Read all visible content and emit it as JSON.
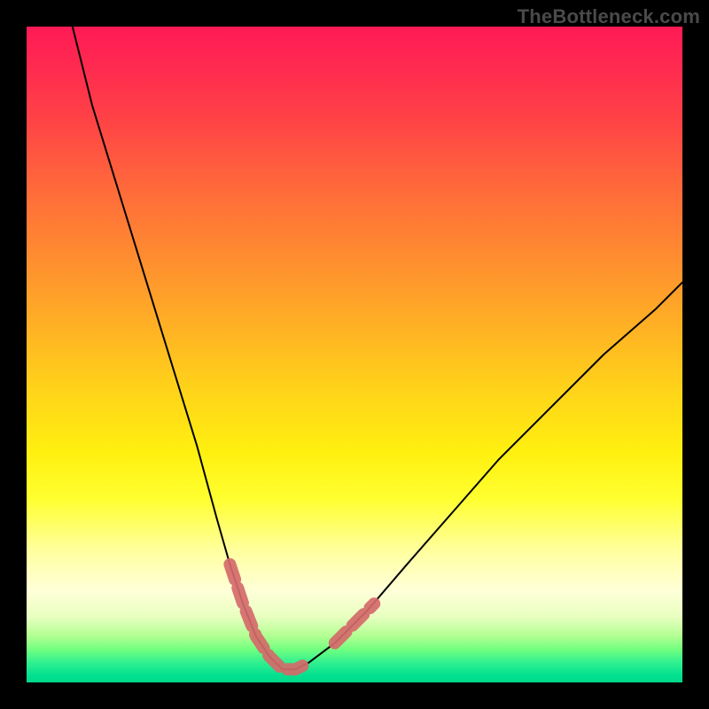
{
  "watermark": "TheBottleneck.com",
  "chart_data": {
    "type": "line",
    "title": "",
    "xlabel": "",
    "ylabel": "",
    "xlim": [
      0,
      100
    ],
    "ylim": [
      0,
      100
    ],
    "grid": false,
    "series": [
      {
        "name": "bottleneck-curve",
        "x": [
          7,
          10,
          14,
          18,
          22,
          26,
          29,
          31,
          33,
          35,
          37,
          39,
          41,
          43,
          47,
          52,
          58,
          65,
          72,
          80,
          88,
          96,
          100
        ],
        "y": [
          100,
          88,
          75,
          62,
          49,
          36,
          25,
          18,
          12,
          7,
          4,
          2,
          2,
          3,
          6,
          11,
          18,
          26,
          34,
          42,
          50,
          57,
          61
        ],
        "color": "#000000",
        "stroke_width": 2
      }
    ],
    "highlight_segments": [
      {
        "name": "left-dip-marker",
        "x": [
          31,
          33,
          35,
          37,
          39,
          41,
          43
        ],
        "y": [
          18,
          12,
          7,
          4,
          2,
          2,
          3
        ],
        "color": "#d46a6a",
        "stroke_width": 14
      },
      {
        "name": "right-dip-marker",
        "x": [
          47,
          49,
          51,
          53
        ],
        "y": [
          6,
          8,
          10,
          12
        ],
        "color": "#d46a6a",
        "stroke_width": 14
      }
    ]
  }
}
